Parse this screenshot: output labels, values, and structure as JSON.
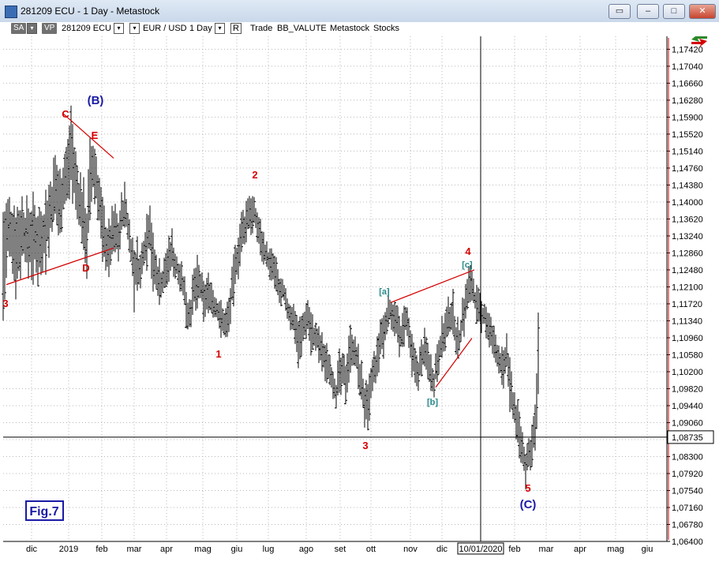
{
  "window": {
    "title": "281209 ECU - 1 Day - Metastock",
    "buttons": [
      "restore-down",
      "minimize",
      "maximize",
      "close"
    ]
  },
  "toolbar": {
    "sa_label": "SA",
    "vp_label": "VP",
    "symbol": "281209 ECU",
    "pair": "EUR / USD",
    "period": "1 Day",
    "r_label": "R",
    "trade": "Trade",
    "indicator": "BB_VALUTE",
    "metastock": "Metastock",
    "stocks": "Stocks"
  },
  "colors": {
    "price_bars": "#000000",
    "wave_red": "#d40000",
    "wave_blue": "#1a1aa6",
    "wave_teal": "#2a8a8a",
    "trendline": "#d40000"
  },
  "chart_data": {
    "type": "bar",
    "subtype": "ohlc-price-bars",
    "y_axis": {
      "side": "right",
      "ticks": [
        "1,17420",
        "1,17040",
        "1,16660",
        "1,16280",
        "1,15900",
        "1,15520",
        "1,15140",
        "1,14760",
        "1,14380",
        "1,14000",
        "1,13620",
        "1,13240",
        "1,12860",
        "1,12480",
        "1,12100",
        "1,11720",
        "1,11340",
        "1,10960",
        "1,10580",
        "1,10200",
        "1,09820",
        "1,09440",
        "1,09060",
        "1,08680",
        "1,08300",
        "1,07920",
        "1,07540",
        "1,07160",
        "1,06780",
        "1,06400"
      ],
      "range": [
        1.064,
        1.1771
      ]
    },
    "x_axis": {
      "ticks": [
        "dic",
        "2019",
        "feb",
        "mar",
        "apr",
        "mag",
        "giu",
        "lug",
        "ago",
        "set",
        "ott",
        "nov",
        "dic",
        "10/01/2020",
        "feb",
        "mar",
        "apr",
        "mag",
        "giu"
      ],
      "highlighted": "10/01/2020"
    },
    "current_price": {
      "value": 1.08735,
      "label": "1,08735"
    },
    "crosshair_date": "10/01/2020",
    "trend": [
      [
        0,
        1.123,
        1.148,
        1.126
      ],
      [
        6,
        1.13,
        1.144,
        1.133
      ],
      [
        12,
        1.128,
        1.146,
        1.132
      ],
      [
        18,
        1.125,
        1.143,
        1.13
      ],
      [
        24,
        1.13,
        1.144,
        1.134
      ],
      [
        30,
        1.126,
        1.14,
        1.132
      ],
      [
        36,
        1.127,
        1.143,
        1.132
      ],
      [
        42,
        1.126,
        1.142,
        1.131
      ],
      [
        48,
        1.129,
        1.142,
        1.132
      ],
      [
        54,
        1.128,
        1.144,
        1.134
      ],
      [
        60,
        1.132,
        1.146,
        1.138
      ],
      [
        66,
        1.133,
        1.149,
        1.142
      ],
      [
        72,
        1.135,
        1.148,
        1.14
      ],
      [
        78,
        1.138,
        1.151,
        1.145
      ],
      [
        82,
        1.14,
        1.153,
        1.147
      ],
      [
        86,
        1.143,
        1.159,
        1.154
      ],
      [
        90,
        1.14,
        1.154,
        1.146
      ],
      [
        94,
        1.137,
        1.15,
        1.142
      ],
      [
        98,
        1.133,
        1.147,
        1.139
      ],
      [
        102,
        1.131,
        1.145,
        1.136
      ],
      [
        106,
        1.128,
        1.142,
        1.132
      ],
      [
        110,
        1.132,
        1.148,
        1.144
      ],
      [
        114,
        1.137,
        1.151,
        1.147
      ],
      [
        118,
        1.14,
        1.152,
        1.145
      ],
      [
        122,
        1.136,
        1.147,
        1.14
      ],
      [
        126,
        1.131,
        1.142,
        1.134
      ],
      [
        130,
        1.127,
        1.138,
        1.131
      ],
      [
        134,
        1.125,
        1.136,
        1.129
      ],
      [
        138,
        1.128,
        1.137,
        1.133
      ],
      [
        142,
        1.13,
        1.139,
        1.134
      ],
      [
        146,
        1.13,
        1.138,
        1.132
      ],
      [
        150,
        1.132,
        1.14,
        1.137
      ],
      [
        154,
        1.134,
        1.143,
        1.139
      ],
      [
        158,
        1.133,
        1.14,
        1.135
      ],
      [
        162,
        1.129,
        1.136,
        1.13
      ],
      [
        166,
        1.118,
        1.132,
        1.123
      ],
      [
        170,
        1.12,
        1.13,
        1.126
      ],
      [
        174,
        1.121,
        1.129,
        1.124
      ],
      [
        178,
        1.123,
        1.132,
        1.129
      ],
      [
        182,
        1.126,
        1.137,
        1.132
      ],
      [
        186,
        1.128,
        1.142,
        1.135
      ],
      [
        190,
        1.122,
        1.133,
        1.126
      ],
      [
        194,
        1.121,
        1.129,
        1.124
      ],
      [
        198,
        1.118,
        1.127,
        1.122
      ],
      [
        202,
        1.119,
        1.125,
        1.122
      ],
      [
        206,
        1.12,
        1.128,
        1.125
      ],
      [
        210,
        1.122,
        1.13,
        1.127
      ],
      [
        214,
        1.125,
        1.133,
        1.129
      ],
      [
        218,
        1.124,
        1.13,
        1.126
      ],
      [
        222,
        1.123,
        1.128,
        1.125
      ],
      [
        226,
        1.12,
        1.127,
        1.123
      ],
      [
        230,
        1.116,
        1.124,
        1.119
      ],
      [
        234,
        1.113,
        1.12,
        1.115
      ],
      [
        238,
        1.111,
        1.119,
        1.116
      ],
      [
        242,
        1.114,
        1.123,
        1.12
      ],
      [
        246,
        1.117,
        1.126,
        1.122
      ],
      [
        250,
        1.118,
        1.125,
        1.121
      ],
      [
        254,
        1.116,
        1.123,
        1.118
      ],
      [
        258,
        1.115,
        1.123,
        1.119
      ],
      [
        262,
        1.117,
        1.124,
        1.12
      ],
      [
        266,
        1.114,
        1.122,
        1.117
      ],
      [
        270,
        1.114,
        1.12,
        1.116
      ],
      [
        274,
        1.112,
        1.119,
        1.115
      ],
      [
        278,
        1.111,
        1.117,
        1.113
      ],
      [
        282,
        1.11,
        1.116,
        1.113
      ],
      [
        286,
        1.111,
        1.118,
        1.115
      ],
      [
        290,
        1.115,
        1.123,
        1.12
      ],
      [
        294,
        1.119,
        1.128,
        1.125
      ],
      [
        298,
        1.122,
        1.132,
        1.129
      ],
      [
        302,
        1.126,
        1.136,
        1.132
      ],
      [
        306,
        1.129,
        1.138,
        1.134
      ],
      [
        310,
        1.13,
        1.14,
        1.137
      ],
      [
        314,
        1.133,
        1.141,
        1.138
      ],
      [
        318,
        1.134,
        1.14,
        1.137
      ],
      [
        322,
        1.133,
        1.139,
        1.135
      ],
      [
        326,
        1.13,
        1.137,
        1.132
      ],
      [
        330,
        1.128,
        1.134,
        1.13
      ],
      [
        334,
        1.126,
        1.131,
        1.128
      ],
      [
        338,
        1.123,
        1.129,
        1.126
      ],
      [
        342,
        1.121,
        1.128,
        1.125
      ],
      [
        346,
        1.12,
        1.127,
        1.123
      ],
      [
        350,
        1.118,
        1.124,
        1.12
      ],
      [
        354,
        1.118,
        1.122,
        1.12
      ],
      [
        358,
        1.116,
        1.12,
        1.118
      ],
      [
        362,
        1.113,
        1.119,
        1.115
      ],
      [
        366,
        1.111,
        1.118,
        1.114
      ],
      [
        370,
        1.11,
        1.117,
        1.113
      ],
      [
        374,
        1.106,
        1.115,
        1.109
      ],
      [
        378,
        1.105,
        1.113,
        1.11
      ],
      [
        382,
        1.109,
        1.116,
        1.113
      ],
      [
        386,
        1.111,
        1.118,
        1.115
      ],
      [
        390,
        1.108,
        1.116,
        1.111
      ],
      [
        394,
        1.107,
        1.113,
        1.11
      ],
      [
        398,
        1.106,
        1.112,
        1.109
      ],
      [
        402,
        1.105,
        1.112,
        1.107
      ],
      [
        406,
        1.102,
        1.11,
        1.105
      ],
      [
        410,
        1.101,
        1.108,
        1.104
      ],
      [
        414,
        1.1,
        1.106,
        1.103
      ],
      [
        418,
        1.098,
        1.104,
        1.1
      ],
      [
        422,
        1.094,
        1.102,
        1.097
      ],
      [
        426,
        1.095,
        1.104,
        1.101
      ],
      [
        430,
        1.099,
        1.105,
        1.102
      ],
      [
        434,
        1.097,
        1.106,
        1.1
      ],
      [
        438,
        1.099,
        1.109,
        1.106
      ],
      [
        442,
        1.103,
        1.111,
        1.108
      ],
      [
        446,
        1.104,
        1.11,
        1.106
      ],
      [
        450,
        1.1,
        1.108,
        1.103
      ],
      [
        454,
        1.096,
        1.105,
        1.099
      ],
      [
        458,
        1.092,
        1.101,
        1.095
      ],
      [
        462,
        1.089,
        1.098,
        1.093
      ],
      [
        466,
        1.093,
        1.101,
        1.099
      ],
      [
        470,
        1.097,
        1.105,
        1.102
      ],
      [
        474,
        1.099,
        1.108,
        1.104
      ],
      [
        478,
        1.102,
        1.112,
        1.109
      ],
      [
        482,
        1.105,
        1.114,
        1.11
      ],
      [
        486,
        1.108,
        1.117,
        1.114
      ],
      [
        490,
        1.112,
        1.119,
        1.116
      ],
      [
        494,
        1.113,
        1.119,
        1.115
      ],
      [
        498,
        1.11,
        1.117,
        1.113
      ],
      [
        502,
        1.107,
        1.115,
        1.11
      ],
      [
        506,
        1.106,
        1.114,
        1.11
      ],
      [
        510,
        1.109,
        1.117,
        1.114
      ],
      [
        514,
        1.107,
        1.115,
        1.11
      ],
      [
        518,
        1.103,
        1.111,
        1.105
      ],
      [
        522,
        1.1,
        1.107,
        1.103
      ],
      [
        526,
        1.099,
        1.106,
        1.102
      ],
      [
        530,
        1.101,
        1.108,
        1.105
      ],
      [
        534,
        1.103,
        1.11,
        1.107
      ],
      [
        538,
        1.102,
        1.109,
        1.105
      ],
      [
        542,
        1.1,
        1.107,
        1.102
      ],
      [
        546,
        1.098,
        1.104,
        1.1
      ],
      [
        550,
        1.1,
        1.108,
        1.105
      ],
      [
        554,
        1.103,
        1.111,
        1.108
      ],
      [
        558,
        1.105,
        1.113,
        1.11
      ],
      [
        562,
        1.107,
        1.115,
        1.112
      ],
      [
        566,
        1.108,
        1.117,
        1.114
      ],
      [
        570,
        1.11,
        1.118,
        1.115
      ],
      [
        574,
        1.108,
        1.115,
        1.11
      ],
      [
        578,
        1.106,
        1.113,
        1.109
      ],
      [
        582,
        1.108,
        1.117,
        1.114
      ],
      [
        586,
        1.112,
        1.12,
        1.117
      ],
      [
        590,
        1.116,
        1.124,
        1.121
      ],
      [
        594,
        1.119,
        1.125,
        1.122
      ],
      [
        598,
        1.116,
        1.123,
        1.118
      ],
      [
        602,
        1.113,
        1.12,
        1.116
      ],
      [
        606,
        1.111,
        1.118,
        1.114
      ],
      [
        610,
        1.112,
        1.118,
        1.115
      ],
      [
        614,
        1.109,
        1.117,
        1.112
      ],
      [
        618,
        1.107,
        1.114,
        1.11
      ],
      [
        622,
        1.105,
        1.112,
        1.108
      ],
      [
        626,
        1.103,
        1.11,
        1.106
      ],
      [
        630,
        1.101,
        1.108,
        1.104
      ],
      [
        634,
        1.099,
        1.106,
        1.102
      ],
      [
        638,
        1.1,
        1.109,
        1.106
      ],
      [
        642,
        1.096,
        1.105,
        1.099
      ],
      [
        646,
        1.093,
        1.101,
        1.095
      ],
      [
        650,
        1.09,
        1.098,
        1.092
      ],
      [
        654,
        1.086,
        1.095,
        1.088
      ],
      [
        658,
        1.082,
        1.091,
        1.084
      ],
      [
        662,
        1.079,
        1.087,
        1.081
      ],
      [
        666,
        1.078,
        1.086,
        1.083
      ],
      [
        670,
        1.08,
        1.088,
        1.086
      ],
      [
        674,
        1.083,
        1.092,
        1.089
      ],
      [
        678,
        1.087,
        1.106,
        1.102
      ]
    ],
    "trendlines": [
      {
        "from": [
          76,
          1.1598
        ],
        "to": [
          140,
          1.1498
        ]
      },
      {
        "from": [
          4,
          1.1215
        ],
        "to": [
          140,
          1.1297
        ]
      },
      {
        "from": [
          491,
          1.1175
        ],
        "to": [
          597,
          1.1248
        ]
      },
      {
        "from": [
          548,
          1.0985
        ],
        "to": [
          594,
          1.1095
        ]
      }
    ],
    "annotations": [
      {
        "text": "C",
        "color": "red"
      },
      {
        "text": "(B)",
        "color": "blue"
      },
      {
        "text": "E",
        "color": "red"
      },
      {
        "text": "2",
        "color": "red"
      },
      {
        "text": "D",
        "color": "red"
      },
      {
        "text": "3",
        "color": "red"
      },
      {
        "text": "1",
        "color": "red"
      },
      {
        "text": "[a]",
        "color": "teal"
      },
      {
        "text": "[c]",
        "color": "teal"
      },
      {
        "text": "4",
        "color": "red"
      },
      {
        "text": "[b]",
        "color": "teal"
      },
      {
        "text": "3",
        "color": "red"
      },
      {
        "text": "5",
        "color": "red"
      },
      {
        "text": "(C)",
        "color": "blue"
      }
    ],
    "figure_label": "Fig.7",
    "grid": "dotted-vertical-horizontal"
  }
}
